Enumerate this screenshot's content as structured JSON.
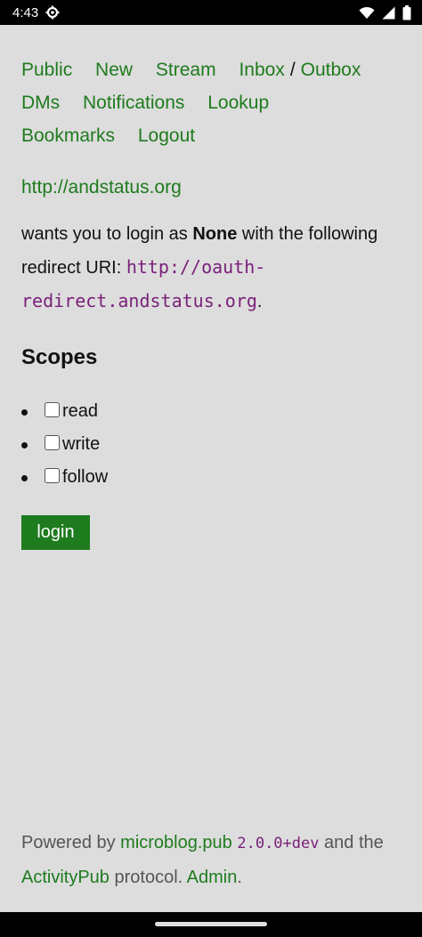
{
  "status_bar": {
    "time": "4:43",
    "icons": [
      "settings-gear-icon",
      "wifi-icon",
      "signal-icon",
      "battery-icon"
    ]
  },
  "nav": {
    "public": "Public",
    "new": "New",
    "stream": "Stream",
    "inbox": "Inbox",
    "separator": "/",
    "outbox": "Outbox",
    "dms": "DMs",
    "notifications": "Notifications",
    "lookup": "Lookup",
    "bookmarks": "Bookmarks",
    "logout": "Logout"
  },
  "client_url": "http://andstatus.org",
  "intro": {
    "prefix": "wants you to login as ",
    "user": "None",
    "middle": " with the following redirect URI: ",
    "redirect_uri": "http://oauth-redirect.andstatus.org",
    "suffix": "."
  },
  "scopes": {
    "title": "Scopes",
    "items": [
      {
        "label": "read",
        "checked": false
      },
      {
        "label": "write",
        "checked": false
      },
      {
        "label": "follow",
        "checked": false
      }
    ]
  },
  "login_label": "login",
  "footer": {
    "powered_by": "Powered by ",
    "app_link": "microblog.pub",
    "version": "2.0.0+dev",
    "and_the": " and the ",
    "protocol_link": "ActivityPub",
    "protocol_text": " protocol. ",
    "admin_link": "Admin",
    "end": "."
  },
  "colors": {
    "link": "#1e7b1e",
    "background": "#dddddd",
    "code": "#7a1f7a",
    "button": "#1e7b1e"
  }
}
